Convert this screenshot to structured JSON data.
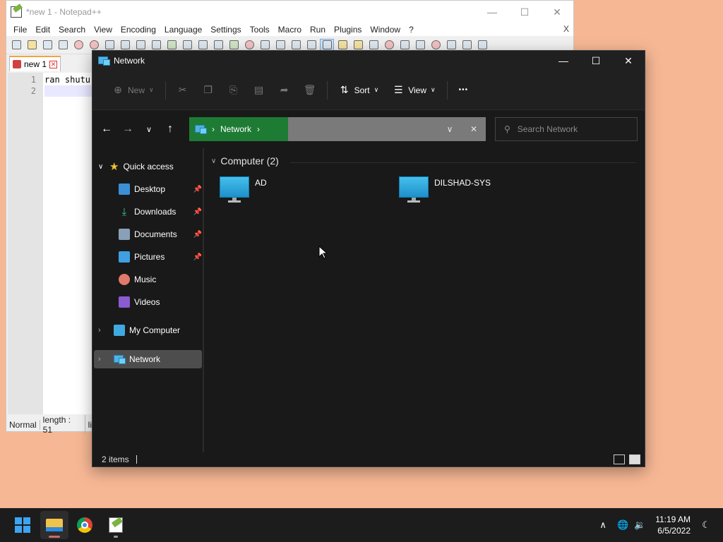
{
  "notepad": {
    "title": "*new 1 - Notepad++",
    "menu": [
      "File",
      "Edit",
      "Search",
      "View",
      "Encoding",
      "Language",
      "Settings",
      "Tools",
      "Macro",
      "Run",
      "Plugins",
      "Window",
      "?"
    ],
    "menu_close": "X",
    "tab_label": "new 1",
    "line_numbers": [
      "1",
      "2"
    ],
    "line1_text": "ran shutu",
    "status": {
      "mode": "Normal",
      "length": "length : 51",
      "extra": "li"
    }
  },
  "explorer": {
    "title": "Network",
    "toolbar": {
      "new_label": "New",
      "sort_label": "Sort",
      "view_label": "View",
      "more_label": "•••"
    },
    "address": {
      "crumb": "Network"
    },
    "search": {
      "placeholder": "Search Network"
    },
    "nav": {
      "quick_access": "Quick access",
      "items": [
        {
          "label": "Desktop",
          "pinned": true
        },
        {
          "label": "Downloads",
          "pinned": true
        },
        {
          "label": "Documents",
          "pinned": true
        },
        {
          "label": "Pictures",
          "pinned": true
        },
        {
          "label": "Music",
          "pinned": false
        },
        {
          "label": "Videos",
          "pinned": false
        }
      ],
      "my_computer": "My Computer",
      "network": "Network"
    },
    "group": {
      "header": "Computer (2)"
    },
    "computers": [
      "AD",
      "DILSHAD-SYS"
    ],
    "status": {
      "items": "2 items"
    }
  },
  "taskbar": {
    "time": "11:19 AM",
    "date": "6/5/2022"
  },
  "colors": {
    "desktop": "#f6b794",
    "explorer_bg": "#191919",
    "address_crumb": "#1e7b34",
    "selection": "#4d4d4d"
  }
}
